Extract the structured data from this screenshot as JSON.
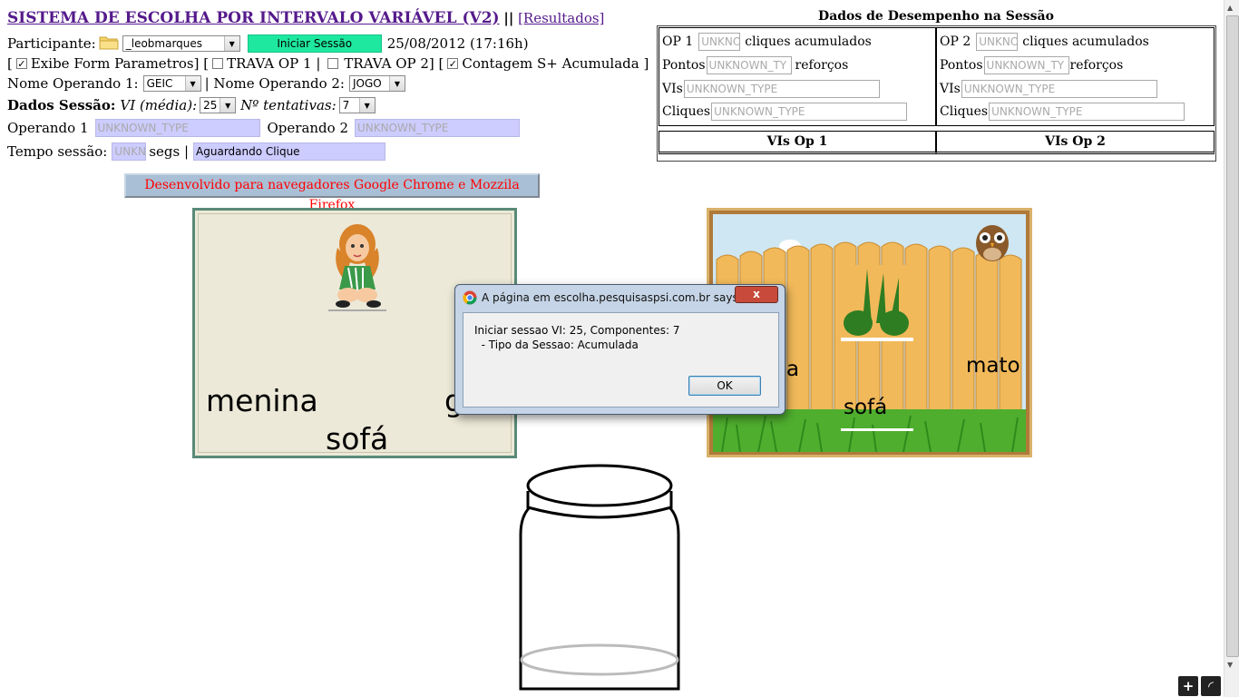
{
  "header": {
    "title": "SISTEMA DE ESCOLHA POR INTERVALO VARIÁVEL (V2)",
    "separator": "||",
    "results_link": "[Resultados]"
  },
  "participant": {
    "label": "Participante:",
    "value": "_leobmarques",
    "start_button": "Iniciar Sessão",
    "datetime": "25/08/2012 (17:16h)"
  },
  "options": {
    "open1": "[",
    "exibe_label": "Exibe Form Parametros] [",
    "exibe_checked": "✓",
    "trava1_label": "TRAVA OP 1 |",
    "trava2_label": "TRAVA OP 2] [",
    "contagem_label": "Contagem S+ Acumulada ]",
    "contagem_checked": "✓"
  },
  "operand_names": {
    "op1_label": "Nome Operando 1:",
    "op1_value": "GEIC",
    "sep": "| Nome Operando 2:",
    "op2_value": "JOGO"
  },
  "session": {
    "label": "Dados Sessão:",
    "vi_label": "VI (média):",
    "vi_value": "25",
    "tries_label": "Nº tentativas:",
    "tries_value": "7"
  },
  "operands_row": {
    "op1_label": "Operando 1",
    "op1_placeholder": "UNKNOWN_TYPE",
    "op2_label": "Operando 2",
    "op2_placeholder": "UNKNOWN_TYPE"
  },
  "time_row": {
    "label": "Tempo sessão:",
    "time_placeholder": "UNKN",
    "secs": "segs |",
    "status": "Aguardando Clique"
  },
  "dev_note": "Desenvolvido para navegadores Google Chrome e Mozzila Firefox",
  "perf": {
    "title": "Dados de Desempenho na Sessão",
    "op1": {
      "label": "OP 1",
      "clicks_placeholder": "UNKNO",
      "clicks_text": "cliques acumulados",
      "pontos_label": "Pontos",
      "pontos_placeholder": "UNKNOWN_TY",
      "reforcos": "reforços",
      "vis_label": "VIs",
      "vis_placeholder": "UNKNOWN_TYPE",
      "cliques_label": "Cliques",
      "cliques_placeholder": "UNKNOWN_TYPE"
    },
    "op2": {
      "label": "OP 2",
      "clicks_placeholder": "UNKNO",
      "clicks_text": "cliques acumulados",
      "pontos_label": "Pontos",
      "pontos_placeholder": "UNKNOWN_TY",
      "reforcos": "reforços",
      "vis_label": "VIs",
      "vis_placeholder": "UNKNOWN_TYPE",
      "cliques_label": "Cliques",
      "cliques_placeholder": "UNKNOWN_TYPE"
    },
    "vis_op1": "VIs Op 1",
    "vis_op2": "VIs Op 2"
  },
  "left_card": {
    "words": [
      "menina",
      "sofá",
      "g"
    ]
  },
  "right_card": {
    "words": [
      "mato",
      "sofá",
      "a"
    ]
  },
  "dialog": {
    "title": "A página em escolha.pesquisaspsi.com.br says:",
    "line1": "Iniciar sessao VI: 25, Componentes: 7",
    "line2": "  - Tipo da Sessao: Acumulada",
    "ok": "OK",
    "close": "x"
  },
  "corner": {
    "plus": "+",
    "other": "◜"
  },
  "colors": {
    "start_button": "#1ee8a0",
    "lavender": "#ccccff",
    "dev_note_text": "#ff0000",
    "dev_note_bg": "#a9bfd6"
  }
}
